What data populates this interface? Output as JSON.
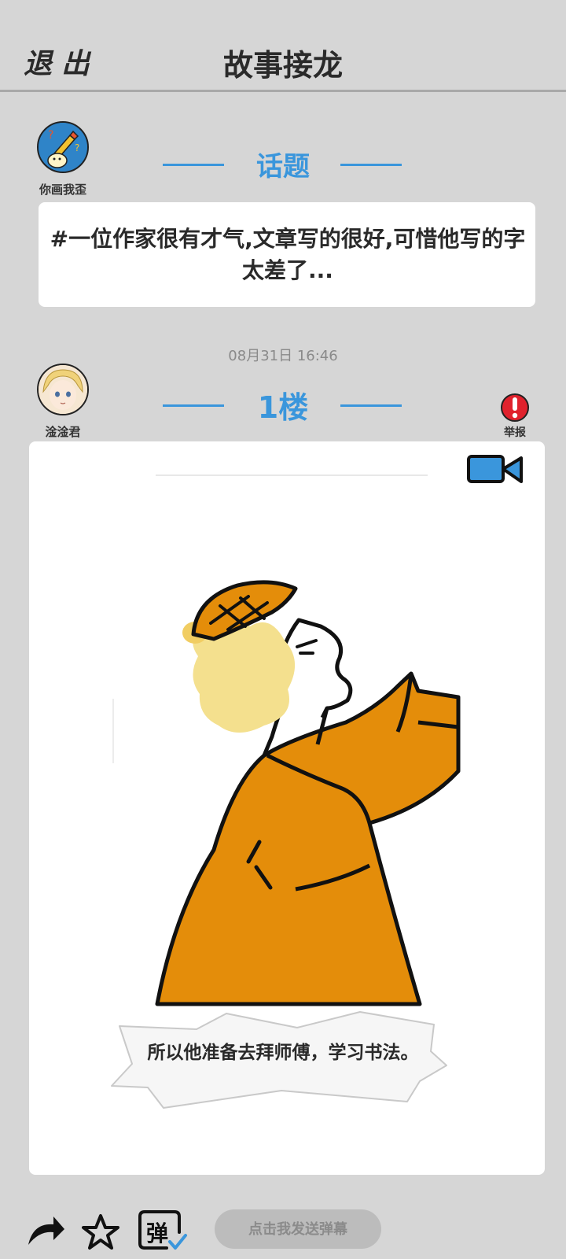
{
  "header": {
    "exit_label": "退出",
    "title": "故事接龙"
  },
  "topic": {
    "author_name": "你画我歪",
    "section_label": "话题",
    "text": "#一位作家很有才气,文章写的很好,可惜他写的字太差了..."
  },
  "post": {
    "timestamp": "08月31日  16:46",
    "author_name": "淦淦君",
    "floor_label": "1楼",
    "report_label": "举报",
    "caption": "所以他准备去拜师傅，学习书法。"
  },
  "toolbar": {
    "share_icon": "share-arrow-icon",
    "favorite_icon": "star-icon",
    "danmaku_toggle_label": "弹",
    "danmaku_placeholder": "点击我发送弹幕"
  },
  "colors": {
    "accent": "#3a96dc",
    "background": "#d6d6d6",
    "report": "#e0222d",
    "figure_orange": "#e48d0a"
  }
}
